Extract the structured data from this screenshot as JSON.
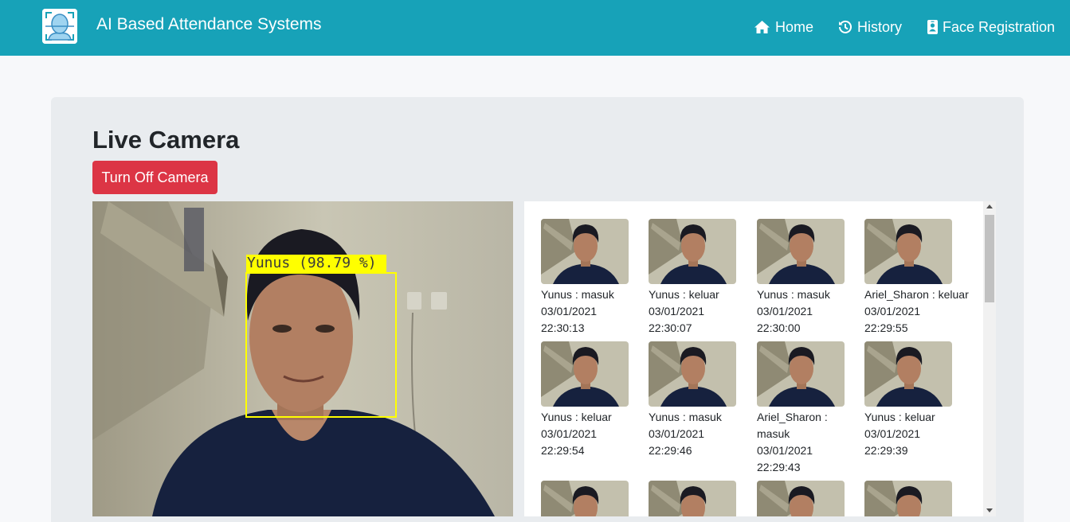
{
  "navbar": {
    "brand": "AI Based Attendance Systems",
    "links": [
      {
        "label": "Home",
        "icon": "home-icon"
      },
      {
        "label": "History",
        "icon": "history-icon"
      },
      {
        "label": "Face Registration",
        "icon": "id-badge-icon"
      }
    ]
  },
  "main": {
    "title": "Live Camera",
    "toggle_button": "Turn Off Camera",
    "camera": {
      "detection_label": "Yunus (98.79 %)"
    },
    "history": [
      {
        "caption": "Yunus : masuk",
        "date": "03/01/2021",
        "time": "22:30:13"
      },
      {
        "caption": "Yunus : keluar",
        "date": "03/01/2021",
        "time": "22:30:07"
      },
      {
        "caption": "Yunus : masuk",
        "date": "03/01/2021",
        "time": "22:30:00"
      },
      {
        "caption": "Ariel_Sharon : keluar",
        "date": "03/01/2021",
        "time": "22:29:55"
      },
      {
        "caption": "Yunus : keluar",
        "date": "03/01/2021",
        "time": "22:29:54"
      },
      {
        "caption": "Yunus : masuk",
        "date": "03/01/2021",
        "time": "22:29:46"
      },
      {
        "caption": "Ariel_Sharon :",
        "caption2": "masuk",
        "date": "03/01/2021",
        "time": "22:29:43"
      },
      {
        "caption": "Yunus : keluar",
        "date": "03/01/2021",
        "time": "22:29:39"
      },
      {
        "caption": "",
        "date": "",
        "time": ""
      },
      {
        "caption": "",
        "date": "",
        "time": ""
      },
      {
        "caption": "",
        "date": "",
        "time": ""
      },
      {
        "caption": "",
        "date": "",
        "time": ""
      }
    ]
  },
  "colors": {
    "navbar": "#17a2b8",
    "danger": "#dc3545",
    "detection": "#ffff00",
    "panel": "#e9ecef"
  }
}
